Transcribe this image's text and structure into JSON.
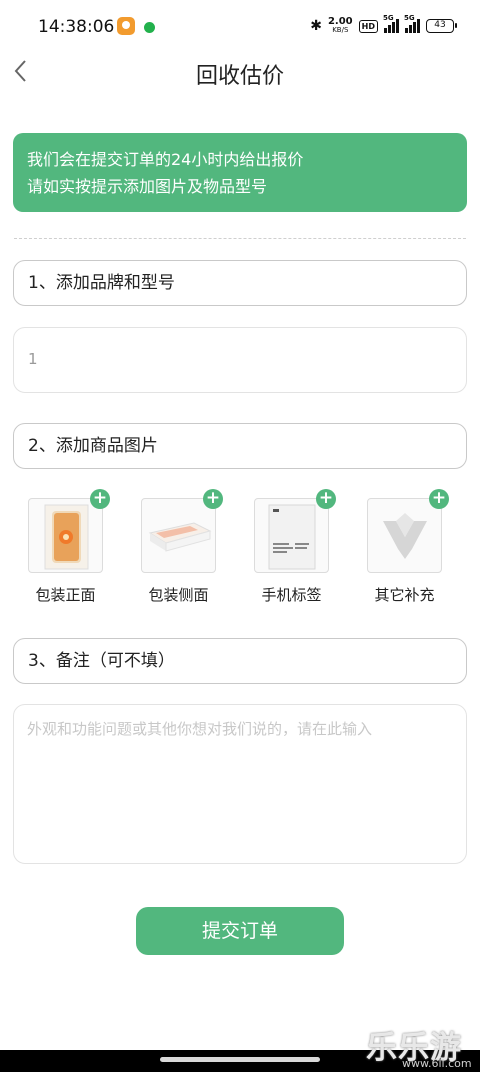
{
  "status_bar": {
    "time": "14:38:06",
    "speed_value": "2.00",
    "speed_unit": "KB/S",
    "hd_badge": "HD",
    "signal1_label": "5G",
    "signal2_label": "5G",
    "battery": "43",
    "icons": [
      "video-app-icon",
      "chat-app-icon",
      "bluetooth-icon",
      "signal-icon",
      "battery-icon"
    ]
  },
  "header": {
    "title": "回收估价",
    "back_icon": "chevron-left-icon"
  },
  "notice": {
    "line1": "我们会在提交订单的24小时内给出报价",
    "line2": "请如实按提示添加图片及物品型号"
  },
  "sections": {
    "brand_model": "1、添加品牌和型号",
    "product_images": "2、添加商品图片",
    "remark": "3、备注（可不填）"
  },
  "model_input": {
    "value": "1"
  },
  "photos": [
    {
      "label": "包装正面",
      "icon": "phone-front-image"
    },
    {
      "label": "包装侧面",
      "icon": "box-side-image"
    },
    {
      "label": "手机标签",
      "icon": "label-image"
    },
    {
      "label": "其它补充",
      "icon": "placeholder-logo-image"
    }
  ],
  "add_symbol": "+",
  "remark_input": {
    "placeholder": "外观和功能问题或其他你想对我们说的，请在此输入"
  },
  "submit_label": "提交订单",
  "watermark": {
    "text": "乐乐游戏",
    "url": "www.6ll.com"
  },
  "colors": {
    "accent": "#52b77e",
    "border": "#c9c9c9"
  }
}
